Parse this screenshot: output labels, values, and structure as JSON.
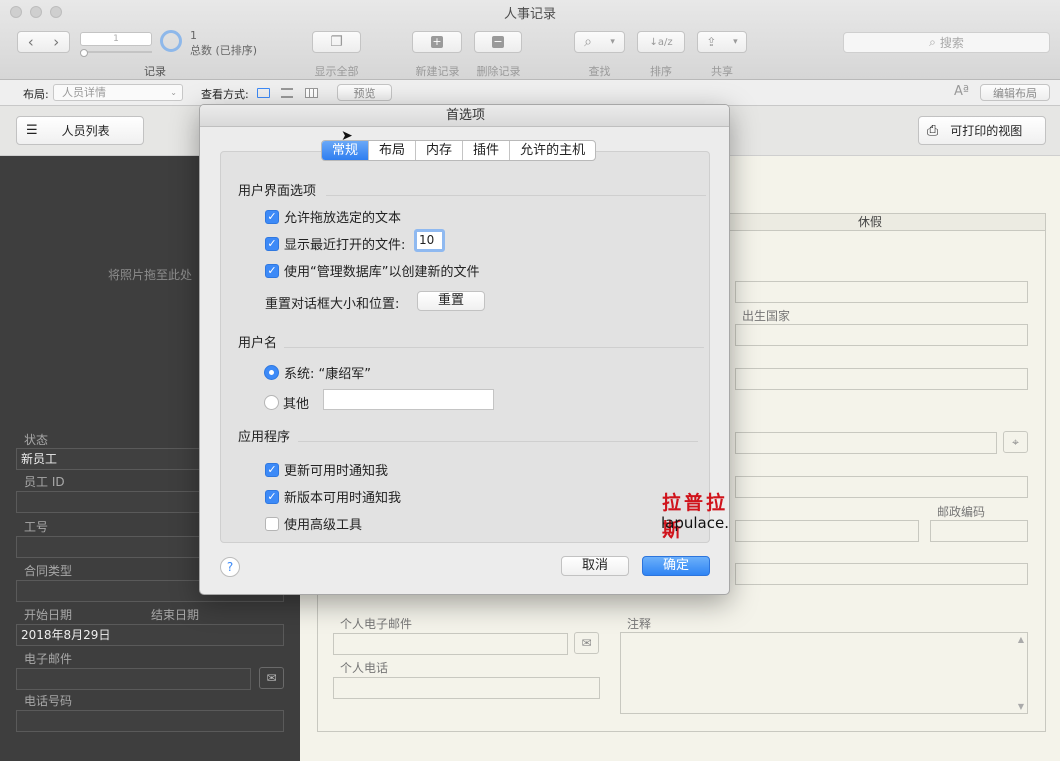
{
  "window": {
    "title": "人事记录"
  },
  "toolbar": {
    "record_slider_value": "1",
    "record_count": "1",
    "record_total": "总数 (已排序)",
    "record_label": "记录",
    "show_all": "显示全部",
    "new_record": "新建记录",
    "delete_record": "删除记录",
    "find": "查找",
    "sort": "排序",
    "share": "共享",
    "search_placeholder": "搜索"
  },
  "layoutbar": {
    "layout_label": "布局:",
    "layout_value": "人员详情",
    "view_label": "查看方式:",
    "preview_button": "预览",
    "text_size_icon": "Aª",
    "edit_layout": "编辑布局"
  },
  "content": {
    "staff_list_button": "人员列表",
    "printable_view": "可打印的视图",
    "photo_drop": "将照片拖至此处",
    "left_fields": {
      "status_label": "状态",
      "status_value": "新员工",
      "employee_id_label": "员工 ID",
      "work_number_label": "工号",
      "contract_type_label": "合同类型",
      "start_date_label": "开始日期",
      "end_date_label": "结束日期",
      "start_date_value": "2018年8月29日",
      "email_label": "电子邮件",
      "phone_label": "电话号码"
    },
    "right_fields": {
      "vacation_header": "休假",
      "birth_country_label": "出生国家",
      "postal_code_label": "邮政编码",
      "personal_email_label": "个人电子邮件",
      "personal_phone_label": "个人电话",
      "notes_label": "注释"
    }
  },
  "dialog": {
    "title": "首选项",
    "tabs": [
      "常规",
      "布局",
      "内存",
      "插件",
      "允许的主机"
    ],
    "active_tab": 0,
    "ui_section": "用户界面选项",
    "options": {
      "drag_drop": {
        "label": "允许拖放选定的文本",
        "checked": true
      },
      "recent_files": {
        "label": "显示最近打开的文件:",
        "checked": true,
        "value": "10"
      },
      "manage_db": {
        "label": "使用“管理数据库”以创建新的文件",
        "checked": true
      }
    },
    "reset_label": "重置对话框大小和位置:",
    "reset_button": "重置",
    "username_section": "用户名",
    "system_radio": "系统: “康绍军”",
    "other_radio": "其他",
    "app_section": "应用程序",
    "app_options": {
      "notify_update": {
        "label": "更新可用时通知我",
        "checked": true
      },
      "notify_version": {
        "label": "新版本可用时通知我",
        "checked": true
      },
      "advanced_tools": {
        "label": "使用高级工具",
        "checked": false
      }
    },
    "help_icon": "?",
    "cancel_button": "取消",
    "ok_button": "确定"
  },
  "watermark": {
    "cn": "拉普拉斯",
    "en": "lapulace.com"
  },
  "colors": {
    "accent": "#3d8af7",
    "watermark_red": "#d0141c"
  }
}
